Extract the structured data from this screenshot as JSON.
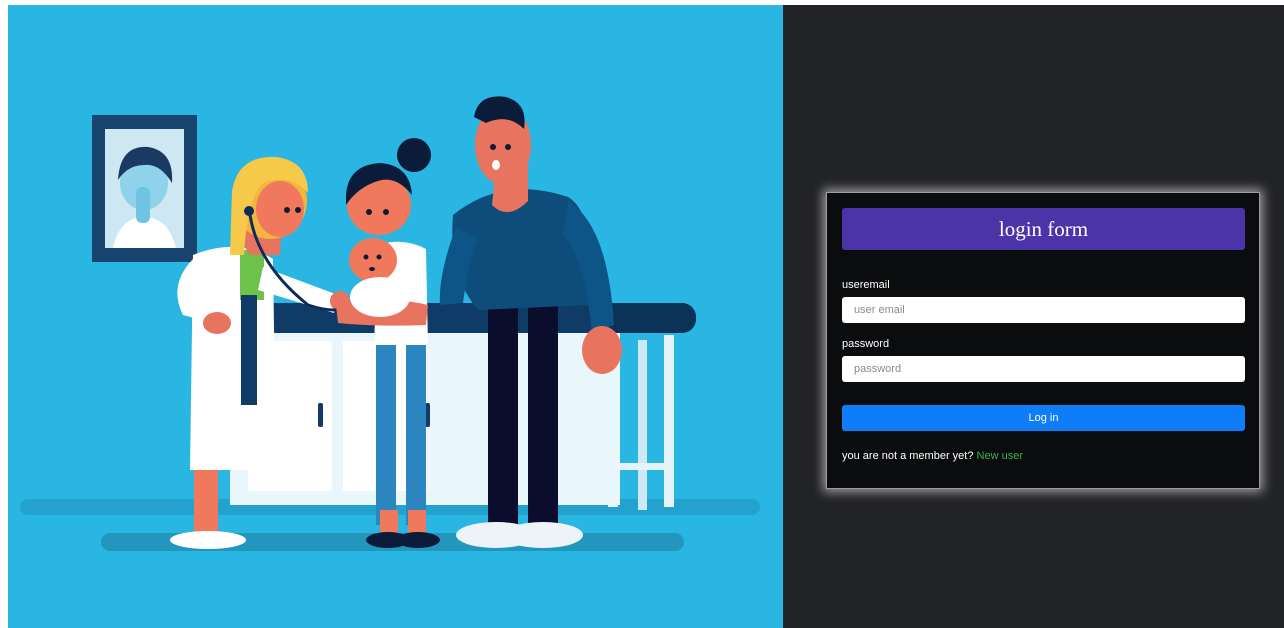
{
  "illustration": {
    "subject": "doctor-examining-baby-with-parents",
    "colors": {
      "background": "#29b6e3",
      "floor_shadow": "#22a2cc",
      "navy": "#0e2c57",
      "skin": "#e8735f"
    }
  },
  "login_form": {
    "title": "login form",
    "email": {
      "label": "useremail",
      "placeholder": "user email",
      "value": ""
    },
    "password": {
      "label": "password",
      "placeholder": "password",
      "value": ""
    },
    "submit_label": "Log in",
    "signup_prompt": "you are not a member yet?",
    "signup_link": "New user"
  },
  "colors": {
    "right_background": "#222327",
    "card_background": "#0b0c0e",
    "header_purple": "#4a34a8",
    "button_blue": "#0f7cf8",
    "link_green": "#2fb34a"
  }
}
